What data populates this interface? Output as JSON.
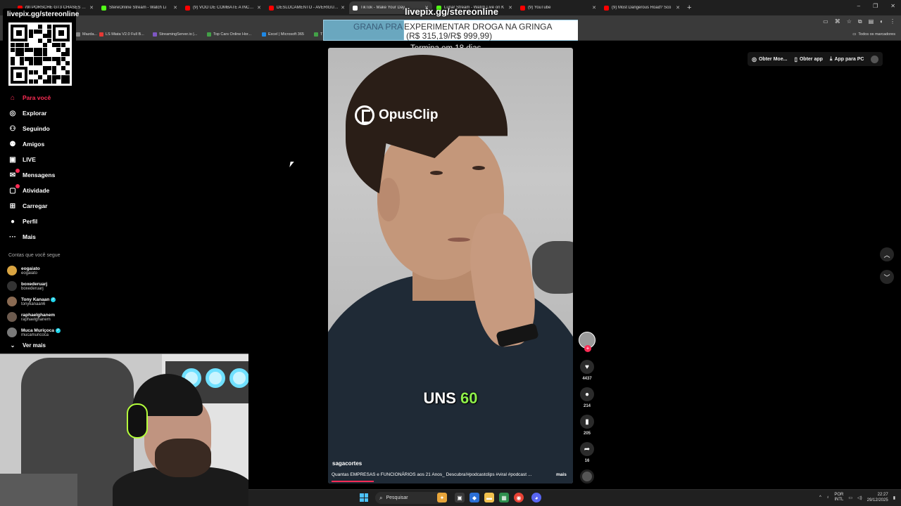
{
  "browser": {
    "tabs": [
      {
        "title": "(9) PORSCHE GT3 CHASES DOW",
        "color": "#ff0000"
      },
      {
        "title": "StereOnline Stream - Watch Li",
        "color": "#53fc18"
      },
      {
        "title": "(9) VOO DE COMBATE A INCÊN",
        "color": "#ff0000"
      },
      {
        "title": "DESLOCAMENTO - AVERIGUAÇ",
        "color": "#ff0000"
      },
      {
        "title": "TikTok - Make Your Day",
        "color": "#ffffff"
      },
      {
        "title": "Lunar Stream - Watch Live on K",
        "color": "#53fc18"
      },
      {
        "title": "(9) YouTube",
        "color": "#ff0000"
      },
      {
        "title": "(9) Most Dangerous Road? Sco",
        "color": "#ff0000"
      }
    ],
    "new_tab_icon": "plus-icon",
    "bookmarks": [
      {
        "label": "Mazda...",
        "color": "#888888"
      },
      {
        "label": "LS Miata V2.0 Full B...",
        "color": "#e53935"
      },
      {
        "label": "StreamingServer.io |...",
        "color": "#7e57c2"
      },
      {
        "label": "Top Cars Online Hor...",
        "color": "#43a047"
      },
      {
        "label": "Excel | Microsoft 365",
        "color": "#1e88e5"
      },
      {
        "label": "T",
        "color": "#43a047"
      }
    ],
    "all_bookmarks": "Todos os marcadores"
  },
  "overlay": {
    "qr_title": "livepix.gg/stereonline",
    "stream_title": "livepix.gg/stereonline",
    "goal_prefix": "GRANA PRA",
    "goal_main": "EXPERIMENTAR DROGA NA GRINGA",
    "goal_amount": "(R$ 315,19/R$ 999,99)",
    "goal_progress": 0.3152,
    "goal_ends": "Termina em 18 dias"
  },
  "sidebar": {
    "items": [
      {
        "label": "Para você",
        "icon": "home-icon"
      },
      {
        "label": "Explorar",
        "icon": "compass-icon"
      },
      {
        "label": "Seguindo",
        "icon": "following-icon"
      },
      {
        "label": "Amigos",
        "icon": "friends-icon"
      },
      {
        "label": "LIVE",
        "icon": "live-icon"
      },
      {
        "label": "Mensagens",
        "icon": "messages-icon"
      },
      {
        "label": "Atividade",
        "icon": "activity-icon"
      },
      {
        "label": "Carregar",
        "icon": "upload-icon"
      },
      {
        "label": "Perfil",
        "icon": "profile-icon"
      },
      {
        "label": "Mais",
        "icon": "more-icon"
      }
    ],
    "following_heading": "Contas que você segue",
    "following": [
      {
        "name": "eogaiato",
        "user": "eogaiato",
        "verified": false
      },
      {
        "name": "boxederuarj",
        "user": "boxederuarj",
        "verified": false
      },
      {
        "name": "Tony Kanaan",
        "user": "tonykanaan6",
        "verified": true
      },
      {
        "name": "raphaelghanem",
        "user": "raphaelghanem",
        "verified": false
      },
      {
        "name": "Muca Muriçoca",
        "user": "mucamuricoca",
        "verified": true
      }
    ],
    "see_more": "Ver mais"
  },
  "top_actions": {
    "coins": "Obter Moe...",
    "app": "Obter app",
    "pc": "App para PC"
  },
  "video": {
    "brand": "OpusClip",
    "caption_word": "UNS",
    "caption_number": "60",
    "author": "sagacortes",
    "description": "Quantas EMPRESAS e FUNCIONÁRIOS aos 21 Anos_ Descubra!#podcastclips #viral #podcast ...",
    "more": "mais"
  },
  "rail": {
    "likes": "4437",
    "comments": "214",
    "saves": "205",
    "shares": "16"
  },
  "taskbar": {
    "search_placeholder": "Pesquisar",
    "lang_top": "POR",
    "lang_bottom": "INTL",
    "time": "22:27",
    "date": "29/12/2025"
  }
}
